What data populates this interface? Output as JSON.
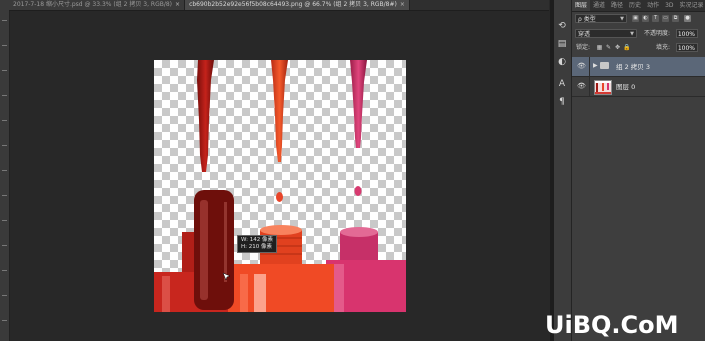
{
  "doc_tabs": [
    {
      "label": "2017-7-18 缩小尺寸.psd @ 33.3% (组 2 拷贝 3, RGB/8)",
      "active": false
    },
    {
      "label": "cb690b2b52e92e56f5b08c64493.png @ 66.7% (组 2 拷贝 3, RGB/8#)",
      "active": true
    }
  ],
  "tooltip": {
    "width_line": "W: 142 像素",
    "height_line": "H: 210 像素"
  },
  "mini_toolbar": [
    "history-icon",
    "properties-icon",
    "adjust-icon",
    "character-icon",
    "paragraph-icon"
  ],
  "panel": {
    "tabs": [
      "图层",
      "通道",
      "路径",
      "历史",
      "动作",
      "3D",
      "实况记录"
    ],
    "active_tab": "图层",
    "filter_kind": "ρ 类型",
    "blend_mode": "穿透",
    "opacity_label": "不透明度:",
    "opacity_value": "100%",
    "lock_label": "锁定:",
    "fill_label": "填充:",
    "fill_value": "100%"
  },
  "layers": [
    {
      "name": "组 2 拷贝 3",
      "type": "group",
      "selected": true,
      "visible": true
    },
    {
      "name": "图层 0",
      "type": "pixel",
      "selected": false,
      "visible": true
    }
  ],
  "watermark": "UiBQ.CoM",
  "colors": {
    "workspace": "#282828",
    "panel": "#3e3e3e",
    "selected_layer": "#5b6778",
    "bottle_red": "#c8261e",
    "bottle_orange": "#f04a25",
    "bottle_pink": "#d8346e",
    "bottle_dark": "#6e0f0b"
  }
}
